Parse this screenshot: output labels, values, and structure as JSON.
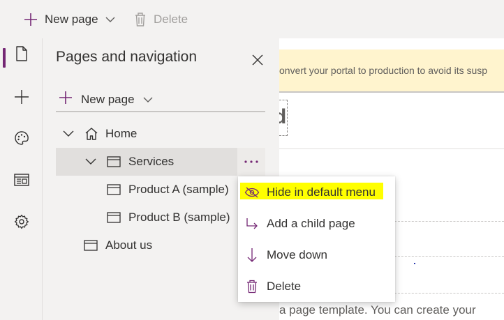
{
  "toolbar": {
    "new_page_label": "New page",
    "delete_label": "Delete"
  },
  "rail": {
    "items": [
      {
        "icon": "page-icon",
        "active": true
      },
      {
        "icon": "plus-icon"
      },
      {
        "icon": "palette-icon"
      },
      {
        "icon": "template-icon"
      },
      {
        "icon": "gear-icon"
      }
    ]
  },
  "background": {
    "banner_text": "onvert your portal to production to avoid its susp",
    "heading_fragment": "d",
    "body_fragment": "a page template. You can create your"
  },
  "panel": {
    "title": "Pages and navigation",
    "new_page_label": "New page",
    "tree": [
      {
        "label": "Home",
        "icon": "home-icon",
        "expanded": true
      },
      {
        "label": "Services",
        "icon": "page-icon",
        "expanded": true,
        "selected": true
      },
      {
        "label": "Product A (sample)",
        "icon": "page-icon"
      },
      {
        "label": "Product B (sample)",
        "icon": "page-icon"
      },
      {
        "label": "About us",
        "icon": "page-icon"
      }
    ]
  },
  "context_menu": {
    "items": [
      {
        "label": "Hide in default menu",
        "icon": "eye-hide-icon",
        "highlighted": true
      },
      {
        "label": "Add a child page",
        "icon": "child-page-icon"
      },
      {
        "label": "Move down",
        "icon": "arrow-down-icon"
      },
      {
        "label": "Delete",
        "icon": "trash-icon"
      }
    ]
  },
  "colors": {
    "accent": "#742774",
    "highlight": "#ffff00",
    "banner": "#fff4ce"
  }
}
